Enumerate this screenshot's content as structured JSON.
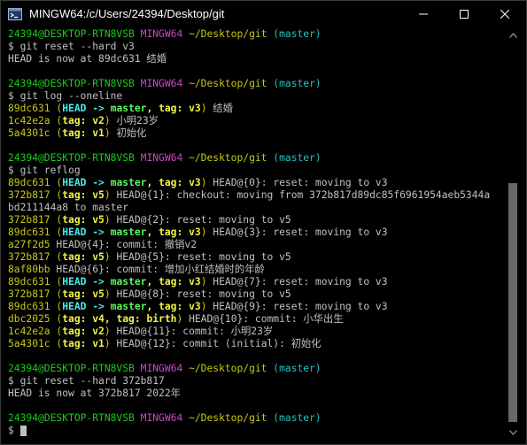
{
  "window": {
    "title": "MINGW64:/c/Users/24394/Desktop/git",
    "icon": "mingw-terminal-icon",
    "controls": {
      "minimize": "minimize-icon",
      "maximize": "maximize-icon",
      "close": "close-icon"
    }
  },
  "colors": {
    "background": "#000000",
    "text": "#c0c0c0",
    "user_host": "#1cc91c",
    "shell_name": "#c848c8",
    "path": "#c8c818",
    "branch": "#28c0c0",
    "head_ref": "#4ee8e8",
    "master_ref": "#5cf55c",
    "tag_ref": "#f2f24a",
    "scroll_thumb": "#686868"
  },
  "prompt": {
    "user_host": "24394@DESKTOP-RTN8VSB",
    "shell": "MINGW64",
    "path": "~/Desktop/git",
    "branch": "(master)",
    "symbol": "$"
  },
  "lines": [
    {
      "type": "prompt"
    },
    {
      "type": "command",
      "text": "$ git reset --hard v3"
    },
    {
      "type": "output",
      "text": "HEAD is now at 89dc631 结婚"
    },
    {
      "type": "blank"
    },
    {
      "type": "prompt"
    },
    {
      "type": "command",
      "text": "$ git log --oneline"
    },
    {
      "type": "log",
      "hash": "89dc631",
      "open": "(",
      "refs": [
        {
          "text": "HEAD -> ",
          "style": "cb"
        },
        {
          "text": "master",
          "style": "gb"
        },
        {
          "text": ", ",
          "style": "yb"
        },
        {
          "text": "tag: v3",
          "style": "yb"
        }
      ],
      "close": ")",
      "rest": " 结婚"
    },
    {
      "type": "log",
      "hash": "1c42e2a",
      "open": "(",
      "refs": [
        {
          "text": "tag: v2",
          "style": "yb"
        }
      ],
      "close": ")",
      "rest": " 小明23岁"
    },
    {
      "type": "log",
      "hash": "5a4301c",
      "open": "(",
      "refs": [
        {
          "text": "tag: v1",
          "style": "yb"
        }
      ],
      "close": ")",
      "rest": " 初始化"
    },
    {
      "type": "blank"
    },
    {
      "type": "prompt"
    },
    {
      "type": "command",
      "text": "$ git reflog"
    },
    {
      "type": "log",
      "hash": "89dc631",
      "open": "(",
      "refs": [
        {
          "text": "HEAD -> ",
          "style": "cb"
        },
        {
          "text": "master",
          "style": "gb"
        },
        {
          "text": ", ",
          "style": "yb"
        },
        {
          "text": "tag: v3",
          "style": "yb"
        }
      ],
      "close": ")",
      "rest": " HEAD@{0}: reset: moving to v3"
    },
    {
      "type": "log",
      "hash": "372b817",
      "open": "(",
      "refs": [
        {
          "text": "tag: v5",
          "style": "yb"
        }
      ],
      "close": ")",
      "rest": " HEAD@{1}: checkout: moving from 372b817d89dc85f6961954aeb5344a"
    },
    {
      "type": "output",
      "text": "bd211144a8 to master"
    },
    {
      "type": "log",
      "hash": "372b817",
      "open": "(",
      "refs": [
        {
          "text": "tag: v5",
          "style": "yb"
        }
      ],
      "close": ")",
      "rest": " HEAD@{2}: reset: moving to v5"
    },
    {
      "type": "log",
      "hash": "89dc631",
      "open": "(",
      "refs": [
        {
          "text": "HEAD -> ",
          "style": "cb"
        },
        {
          "text": "master",
          "style": "gb"
        },
        {
          "text": ", ",
          "style": "yb"
        },
        {
          "text": "tag: v3",
          "style": "yb"
        }
      ],
      "close": ")",
      "rest": " HEAD@{3}: reset: moving to v3"
    },
    {
      "type": "log",
      "hash": "a27f2d5",
      "rest": " HEAD@{4}: commit: 撤销v2"
    },
    {
      "type": "log",
      "hash": "372b817",
      "open": "(",
      "refs": [
        {
          "text": "tag: v5",
          "style": "yb"
        }
      ],
      "close": ")",
      "rest": " HEAD@{5}: reset: moving to v5"
    },
    {
      "type": "log",
      "hash": "8af80bb",
      "rest": " HEAD@{6}: commit: 增加小红结婚时的年龄"
    },
    {
      "type": "log",
      "hash": "89dc631",
      "open": "(",
      "refs": [
        {
          "text": "HEAD -> ",
          "style": "cb"
        },
        {
          "text": "master",
          "style": "gb"
        },
        {
          "text": ", ",
          "style": "yb"
        },
        {
          "text": "tag: v3",
          "style": "yb"
        }
      ],
      "close": ")",
      "rest": " HEAD@{7}: reset: moving to v3"
    },
    {
      "type": "log",
      "hash": "372b817",
      "open": "(",
      "refs": [
        {
          "text": "tag: v5",
          "style": "yb"
        }
      ],
      "close": ")",
      "rest": " HEAD@{8}: reset: moving to v5"
    },
    {
      "type": "log",
      "hash": "89dc631",
      "open": "(",
      "refs": [
        {
          "text": "HEAD -> ",
          "style": "cb"
        },
        {
          "text": "master",
          "style": "gb"
        },
        {
          "text": ", ",
          "style": "yb"
        },
        {
          "text": "tag: v3",
          "style": "yb"
        }
      ],
      "close": ")",
      "rest": " HEAD@{9}: reset: moving to v3"
    },
    {
      "type": "log",
      "hash": "dbc2025",
      "open": "(",
      "refs": [
        {
          "text": "tag: v4, tag: birth",
          "style": "yb"
        }
      ],
      "close": ")",
      "rest": " HEAD@{10}: commit: 小华出生"
    },
    {
      "type": "log",
      "hash": "1c42e2a",
      "open": "(",
      "refs": [
        {
          "text": "tag: v2",
          "style": "yb"
        }
      ],
      "close": ")",
      "rest": " HEAD@{11}: commit: 小明23岁"
    },
    {
      "type": "log",
      "hash": "5a4301c",
      "open": "(",
      "refs": [
        {
          "text": "tag: v1",
          "style": "yb"
        }
      ],
      "close": ")",
      "rest": " HEAD@{12}: commit (initial): 初始化"
    },
    {
      "type": "blank"
    },
    {
      "type": "prompt"
    },
    {
      "type": "command",
      "text": "$ git reset --hard 372b817"
    },
    {
      "type": "output",
      "text": "HEAD is now at 372b817 2022年"
    },
    {
      "type": "blank"
    },
    {
      "type": "prompt"
    },
    {
      "type": "command",
      "text": "$ "
    }
  ]
}
